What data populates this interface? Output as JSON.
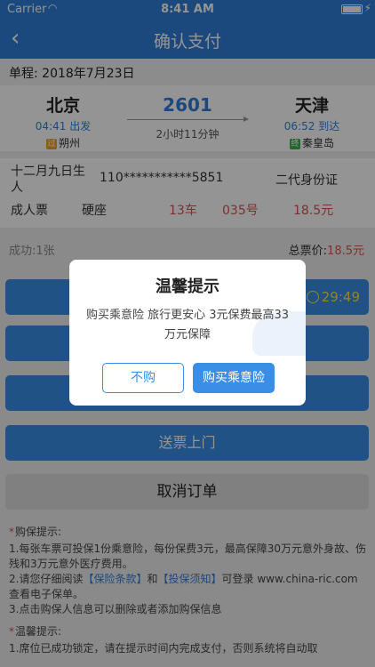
{
  "status": {
    "carrier": "Carrier",
    "time": "8:41 AM"
  },
  "nav": {
    "title": "确认支付"
  },
  "trip": {
    "date": "单程: 2018年7月23日",
    "from_station": "北京",
    "from_time": "04:41 出发",
    "from_origin_badge": "过",
    "from_origin": "朔州",
    "train_no": "2601",
    "duration": "2小时11分钟",
    "to_station": "天津",
    "to_time": "06:52 到达",
    "to_terminal_badge": "终",
    "to_terminal": "秦皇岛"
  },
  "passenger": {
    "name": "十二月九日生人",
    "id_masked": "110***********5851",
    "id_type": "二代身份证",
    "ticket_type": "成人票",
    "seat_class": "硬座",
    "carriage": "13车",
    "seat": "035号",
    "price": "18.5元"
  },
  "summary": {
    "success": "成功:1张",
    "total_label": "总票价:",
    "total_value": "18.5元"
  },
  "buttons": {
    "countdown": "29:49",
    "deliver": "送票上门",
    "cancel": "取消订单"
  },
  "tips": {
    "insurance_header": "购保提示:",
    "line1": "1.每张车票可投保1份乘意险，每份保费3元，最高保障30万元意外身故、伤残和3万元意外医疗费用。",
    "line2_pre": "2.请您仔细阅读",
    "line2_link1": "【保险条款】",
    "line2_and": "和",
    "line2_link2": "【投保须知】",
    "line2_post": "可登录 www.china-ric.com 查看电子保单。",
    "line3": "3.点击购保人信息可以删除或者添加购保信息",
    "warm_header": "温馨提示:",
    "warm_line1": "1.席位已成功锁定，请在提示时间内完成支付，否则系统将自动取"
  },
  "dialog": {
    "title": "温馨提示",
    "message": "购买乘意险 旅行更安心 3元保费最高33万元保障",
    "cancel": "不购",
    "confirm": "购买乘意险"
  }
}
